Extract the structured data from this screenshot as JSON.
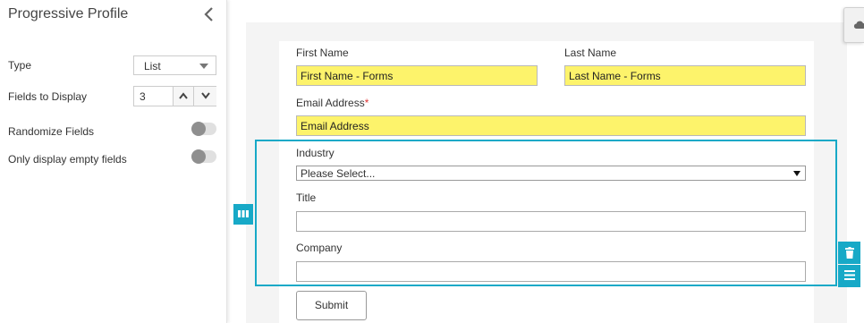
{
  "panel": {
    "title": "Progressive Profile",
    "type_label": "Type",
    "type_value": "List",
    "fields_to_display_label": "Fields to Display",
    "fields_to_display_value": "3",
    "randomize_label": "Randomize Fields",
    "randomize_on": false,
    "empty_only_label": "Only display empty fields",
    "empty_only_on": false
  },
  "form": {
    "first_name_label": "First Name",
    "first_name_value": "First Name - Forms",
    "last_name_label": "Last Name",
    "last_name_value": "Last Name - Forms",
    "email_label": "Email Address",
    "email_required_mark": "*",
    "email_value": "Email Address",
    "industry_label": "Industry",
    "industry_value": "Please Select...",
    "title_label": "Title",
    "title_value": "",
    "company_label": "Company",
    "company_value": "",
    "submit_label": "Submit"
  },
  "icons": {
    "collapse": "chevron-left-icon",
    "drag": "columns-icon",
    "delete": "trash-icon",
    "menu": "hamburger-icon",
    "cloud": "cloud-icon"
  },
  "colors": {
    "accent": "#17a9c7",
    "prefilled_field": "#fdf36b",
    "required": "#dd3333"
  }
}
